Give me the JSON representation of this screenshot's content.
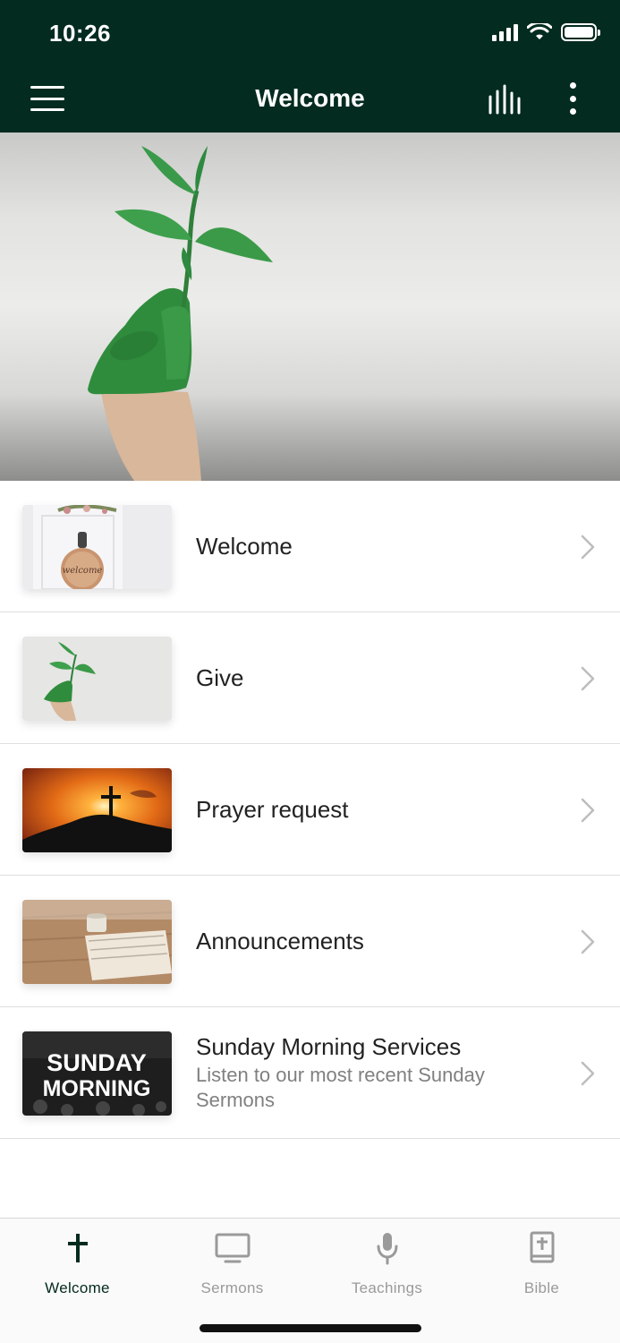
{
  "status_bar": {
    "time": "10:26"
  },
  "header": {
    "title": "Welcome"
  },
  "colors": {
    "header_bg": "#032b1f",
    "active_tab": "#032b1f",
    "inactive_tab": "#9a9a9a"
  },
  "list": {
    "items": [
      {
        "title": "Welcome",
        "subtitle": "",
        "thumbnail": "welcome-door-sign",
        "thumbnail_text": "welcome"
      },
      {
        "title": "Give",
        "subtitle": "",
        "thumbnail": "green-hand-plant"
      },
      {
        "title": "Prayer request",
        "subtitle": "",
        "thumbnail": "sunset-cross"
      },
      {
        "title": "Announcements",
        "subtitle": "",
        "thumbnail": "table-papers"
      },
      {
        "title": "Sunday Morning Services",
        "subtitle": "Listen to our most recent Sunday Sermons",
        "thumbnail": "sunday-morning-banner",
        "thumbnail_text_line1": "SUNDAY",
        "thumbnail_text_line2": "MORNING"
      }
    ]
  },
  "tabs": [
    {
      "label": "Welcome",
      "icon": "cross-icon",
      "active": true
    },
    {
      "label": "Sermons",
      "icon": "monitor-icon",
      "active": false
    },
    {
      "label": "Teachings",
      "icon": "microphone-icon",
      "active": false
    },
    {
      "label": "Bible",
      "icon": "bible-icon",
      "active": false
    }
  ]
}
